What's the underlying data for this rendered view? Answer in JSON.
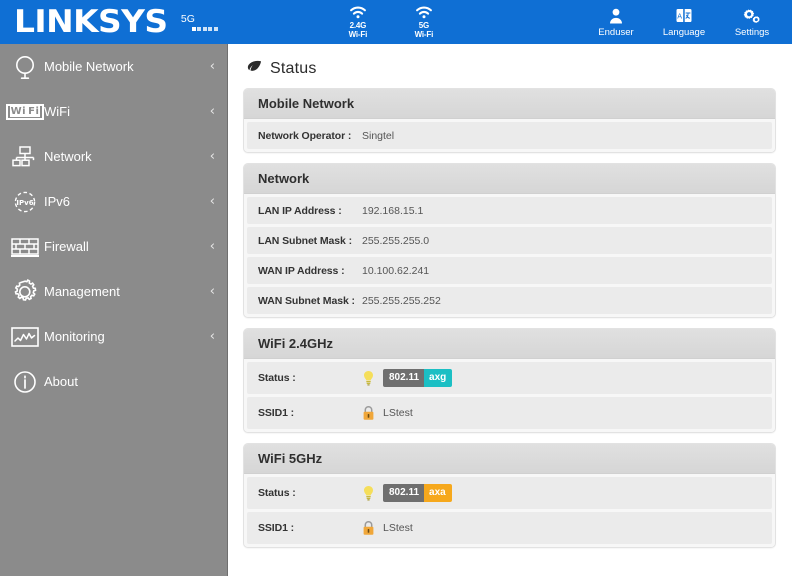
{
  "topbar": {
    "brand": "LINKSYS",
    "signal": {
      "label": "5G",
      "bars_total": 5,
      "bars_active": 1,
      "icon": "signal-bars-icon"
    },
    "wifi_indicators": [
      {
        "icon": "wifi-icon",
        "line1": "2.4G",
        "line2": "Wi-Fi"
      },
      {
        "icon": "wifi-icon",
        "line1": "5G",
        "line2": "Wi-Fi"
      }
    ],
    "actions": [
      {
        "icon": "user-icon",
        "label": "Enduser"
      },
      {
        "icon": "language-icon",
        "label": "Language"
      },
      {
        "icon": "gear-icon",
        "label": "Settings"
      }
    ]
  },
  "sidebar": {
    "items": [
      {
        "label": "Mobile Network",
        "icon": "globe-icon",
        "chevron": "‹",
        "has_chevron": true
      },
      {
        "label": "WiFi",
        "icon": "wifi-text-icon",
        "chevron": "‹",
        "has_chevron": true
      },
      {
        "label": "Network",
        "icon": "network-nodes-icon",
        "chevron": "‹",
        "has_chevron": true
      },
      {
        "label": "IPv6",
        "icon": "ipv6-icon",
        "chevron": "‹",
        "has_chevron": true
      },
      {
        "label": "Firewall",
        "icon": "firewall-brick-icon",
        "chevron": "‹",
        "has_chevron": true
      },
      {
        "label": "Management",
        "icon": "gear-icon",
        "chevron": "‹",
        "has_chevron": true
      },
      {
        "label": "Monitoring",
        "icon": "chart-icon",
        "chevron": "‹",
        "has_chevron": true
      },
      {
        "label": "About",
        "icon": "info-icon",
        "chevron": "",
        "has_chevron": false
      }
    ]
  },
  "main": {
    "page_title": "Status",
    "page_title_icon": "leaf-icon",
    "panels": [
      {
        "title": "Mobile Network",
        "rows": [
          {
            "label": "Network Operator :",
            "value": "Singtel"
          }
        ]
      },
      {
        "title": "Network",
        "rows": [
          {
            "label": "LAN IP Address :",
            "value": "192.168.15.1"
          },
          {
            "label": "LAN Subnet Mask :",
            "value": "255.255.255.0"
          },
          {
            "label": "WAN IP Address :",
            "value": "10.100.62.241"
          },
          {
            "label": "WAN Subnet Mask :",
            "value": "255.255.255.252"
          }
        ]
      },
      {
        "title": "WiFi 2.4GHz",
        "rows": [
          {
            "label": "Status :",
            "icon": "lightbulb-icon",
            "badge": {
              "left": "802.11",
              "right": "axg",
              "right_color": "#1bbfc4"
            }
          },
          {
            "label": "SSID1 :",
            "icon": "lock-icon",
            "value": "LStest"
          }
        ]
      },
      {
        "title": "WiFi 5GHz",
        "rows": [
          {
            "label": "Status :",
            "icon": "lightbulb-icon",
            "badge": {
              "left": "802.11",
              "right": "axa",
              "right_color": "#f6a81c"
            }
          },
          {
            "label": "SSID1 :",
            "icon": "lock-icon",
            "value": "LStest"
          }
        ]
      }
    ]
  },
  "colors": {
    "brand_blue": "#0f6fd4",
    "sidebar_gray": "#8b8b8b",
    "panel_header": "#dcdcdc",
    "row_bg": "#ebebeb",
    "badge_gray": "#6f6f6f",
    "badge_teal": "#1bbfc4",
    "badge_orange": "#f6a81c"
  }
}
